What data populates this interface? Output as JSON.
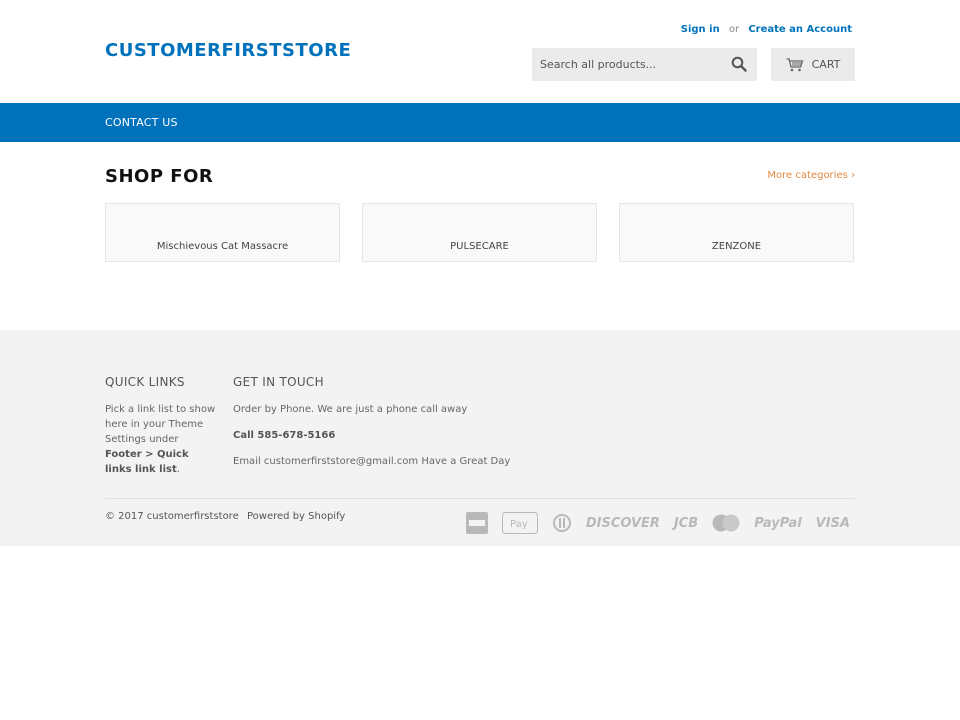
{
  "header": {
    "logo": "CUSTOMERFIRSTSTORE",
    "sign_in": "Sign in",
    "or": "or",
    "create_account": "Create an Account",
    "search_placeholder": "Search all products...",
    "cart_label": "CART"
  },
  "nav": {
    "items": [
      "CONTACT US"
    ]
  },
  "main": {
    "heading": "SHOP FOR",
    "more_categories": "More categories ›",
    "collections": [
      "Mischievous Cat Massacre",
      "PULSECARE",
      "ZENZONE"
    ]
  },
  "footer": {
    "quick_links_title": "QUICK LINKS",
    "quick_links_text_1": "Pick a link list to show here in your Theme Settings under",
    "quick_links_text_bold": "Footer > Quick links link list",
    "quick_links_text_end": ".",
    "get_in_touch_title": "GET IN TOUCH",
    "order_text": "Order by Phone. We are just a phone call away",
    "call_text": "Call 585-678-5166",
    "email_text": "Email customerfirststore@gmail.com Have a Great Day",
    "copyright": "© 2017 customerfirststore",
    "powered": "Powered by Shopify",
    "payments": [
      "american-express",
      "apple-pay",
      "diners-club",
      "discover",
      "jcb",
      "master",
      "paypal",
      "visa"
    ],
    "payment_labels": {
      "applepay": "Pay",
      "discover": "DISCOVER",
      "jcb": "JCB",
      "paypal": "PayPal",
      "visa": "VISA"
    }
  },
  "colors": {
    "brand": "#0072bc",
    "accent": "#e28a3e",
    "footer_bg": "#f3f3f3"
  }
}
